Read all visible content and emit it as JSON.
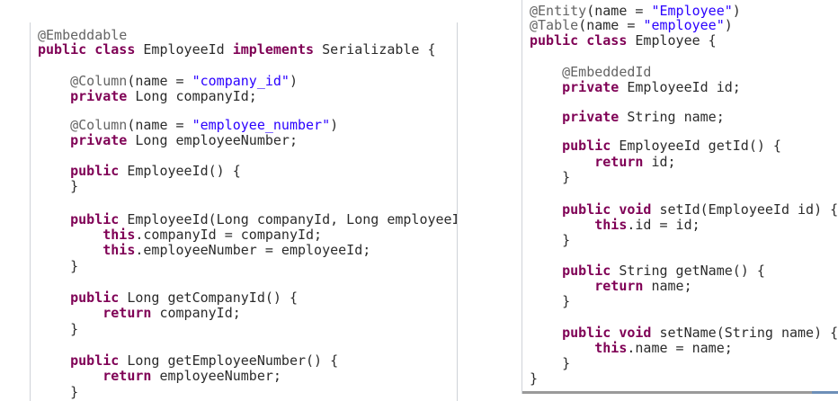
{
  "left_panel": {
    "lines": [
      {
        "tokens": [
          {
            "t": "@Embeddable",
            "k": "ann"
          }
        ]
      },
      {
        "tokens": [
          {
            "t": "public class",
            "k": "kw"
          },
          {
            "t": " EmployeeId ",
            "k": ""
          },
          {
            "t": "implements",
            "k": "kw"
          },
          {
            "t": " Serializable {",
            "k": ""
          }
        ]
      },
      {
        "tokens": [
          {
            "t": "    @Column",
            "k": "ann"
          },
          {
            "t": "(name = ",
            "k": ""
          },
          {
            "t": "\"company_id\"",
            "k": "str"
          },
          {
            "t": ")",
            "k": ""
          }
        ]
      },
      {
        "tokens": [
          {
            "t": "    private",
            "k": "kw"
          },
          {
            "t": " Long companyId;",
            "k": ""
          }
        ]
      },
      {
        "tokens": [
          {
            "t": "    @Column",
            "k": "ann"
          },
          {
            "t": "(name = ",
            "k": ""
          },
          {
            "t": "\"employee_number\"",
            "k": "str"
          },
          {
            "t": ")",
            "k": ""
          }
        ]
      },
      {
        "tokens": [
          {
            "t": "    private",
            "k": "kw"
          },
          {
            "t": " Long employeeNumber;",
            "k": ""
          }
        ]
      },
      {
        "tokens": [
          {
            "t": "    public",
            "k": "kw"
          },
          {
            "t": " EmployeeId() {",
            "k": ""
          }
        ]
      },
      {
        "tokens": [
          {
            "t": "    }",
            "k": ""
          }
        ]
      },
      {
        "tokens": [
          {
            "t": "    public",
            "k": "kw"
          },
          {
            "t": " EmployeeId(Long companyId, Long employeeI",
            "k": ""
          }
        ]
      },
      {
        "tokens": [
          {
            "t": "        this",
            "k": "kw"
          },
          {
            "t": ".companyId = companyId;",
            "k": ""
          }
        ]
      },
      {
        "tokens": [
          {
            "t": "        this",
            "k": "kw"
          },
          {
            "t": ".employeeNumber = employeeId;",
            "k": ""
          }
        ]
      },
      {
        "tokens": [
          {
            "t": "    }",
            "k": ""
          }
        ]
      },
      {
        "tokens": [
          {
            "t": "    public",
            "k": "kw"
          },
          {
            "t": " Long getCompanyId() {",
            "k": ""
          }
        ]
      },
      {
        "tokens": [
          {
            "t": "        return",
            "k": "kw"
          },
          {
            "t": " companyId;",
            "k": ""
          }
        ]
      },
      {
        "tokens": [
          {
            "t": "    }",
            "k": ""
          }
        ]
      },
      {
        "tokens": [
          {
            "t": "    public",
            "k": "kw"
          },
          {
            "t": " Long getEmployeeNumber() {",
            "k": ""
          }
        ]
      },
      {
        "tokens": [
          {
            "t": "        return",
            "k": "kw"
          },
          {
            "t": " employeeNumber;",
            "k": ""
          }
        ]
      },
      {
        "tokens": [
          {
            "t": "    }",
            "k": ""
          }
        ]
      }
    ]
  },
  "right_panel": {
    "lines": [
      {
        "tokens": [
          {
            "t": "@Entity",
            "k": "ann"
          },
          {
            "t": "(name = ",
            "k": ""
          },
          {
            "t": "\"Employee\"",
            "k": "str"
          },
          {
            "t": ")",
            "k": ""
          }
        ]
      },
      {
        "tokens": [
          {
            "t": "@Table",
            "k": "ann"
          },
          {
            "t": "(name = ",
            "k": ""
          },
          {
            "t": "\"employee\"",
            "k": "str"
          },
          {
            "t": ")",
            "k": ""
          }
        ]
      },
      {
        "tokens": [
          {
            "t": "public class",
            "k": "kw"
          },
          {
            "t": " Employee {",
            "k": ""
          }
        ]
      },
      {
        "tokens": [
          {
            "t": "    @EmbeddedId",
            "k": "ann"
          }
        ]
      },
      {
        "tokens": [
          {
            "t": "    private",
            "k": "kw"
          },
          {
            "t": " EmployeeId id;",
            "k": ""
          }
        ]
      },
      {
        "tokens": [
          {
            "t": "    private",
            "k": "kw"
          },
          {
            "t": " String name;",
            "k": ""
          }
        ]
      },
      {
        "tokens": [
          {
            "t": "    public",
            "k": "kw"
          },
          {
            "t": " EmployeeId getId() {",
            "k": ""
          }
        ]
      },
      {
        "tokens": [
          {
            "t": "        return",
            "k": "kw"
          },
          {
            "t": " id;",
            "k": ""
          }
        ]
      },
      {
        "tokens": [
          {
            "t": "    }",
            "k": ""
          }
        ]
      },
      {
        "tokens": [
          {
            "t": "    public void",
            "k": "kw"
          },
          {
            "t": " setId(EmployeeId id) {",
            "k": ""
          }
        ]
      },
      {
        "tokens": [
          {
            "t": "        this",
            "k": "kw"
          },
          {
            "t": ".id = id;",
            "k": ""
          }
        ]
      },
      {
        "tokens": [
          {
            "t": "    }",
            "k": ""
          }
        ]
      },
      {
        "tokens": [
          {
            "t": "    public",
            "k": "kw"
          },
          {
            "t": " String getName() {",
            "k": ""
          }
        ]
      },
      {
        "tokens": [
          {
            "t": "        return",
            "k": "kw"
          },
          {
            "t": " name;",
            "k": ""
          }
        ]
      },
      {
        "tokens": [
          {
            "t": "    }",
            "k": ""
          }
        ]
      },
      {
        "tokens": [
          {
            "t": "    public void",
            "k": "kw"
          },
          {
            "t": " setName(String name) {",
            "k": ""
          }
        ]
      },
      {
        "tokens": [
          {
            "t": "        this",
            "k": "kw"
          },
          {
            "t": ".name = name;",
            "k": ""
          }
        ]
      },
      {
        "tokens": [
          {
            "t": "    }",
            "k": ""
          }
        ]
      },
      {
        "tokens": [
          {
            "t": "}",
            "k": ""
          }
        ]
      }
    ]
  },
  "colors": {
    "keyword": "#7f0055",
    "annotation": "#646464",
    "string": "#2a00ff",
    "highlight": "#fff36b"
  }
}
